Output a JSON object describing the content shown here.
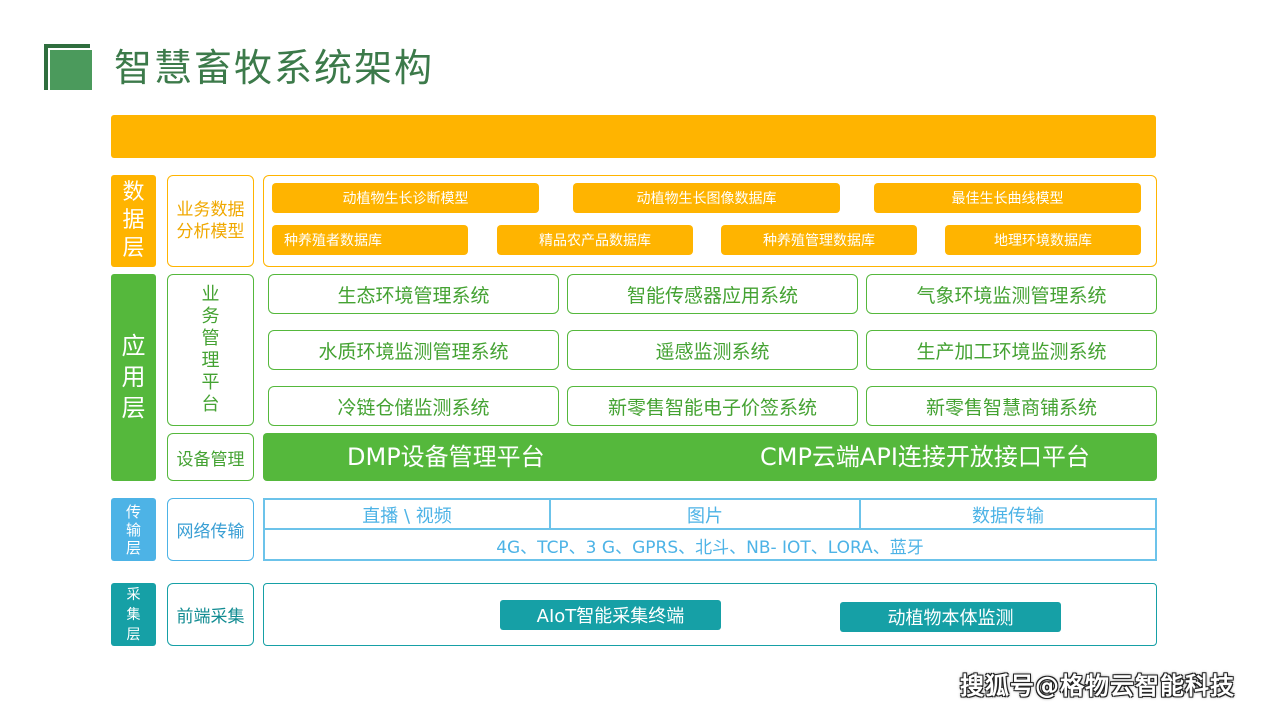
{
  "title": "智慧畜牧系统架构",
  "layers": {
    "data": [
      "数",
      "据",
      "层"
    ],
    "app": [
      "应",
      "用",
      "层"
    ],
    "transport": [
      "传",
      "输",
      "层"
    ],
    "collect": [
      "采",
      "集",
      "层"
    ]
  },
  "labels": {
    "data_model": [
      "业务数据",
      "分析模型"
    ],
    "biz_platform": [
      "业",
      "务",
      "管",
      "理",
      "平",
      "台"
    ],
    "device": "设备管理",
    "network": "网络传输",
    "frontend": "前端采集"
  },
  "data_items": [
    "动植物生长诊断模型",
    "动植物生长图像数据库",
    "最佳生长曲线模型",
    "种养殖者数据库",
    "精品农产品数据库",
    "种养殖管理数据库",
    "地理环境数据库"
  ],
  "app_systems": [
    "生态环境管理系统",
    "智能传感器应用系统",
    "气象环境监测管理系统",
    "水质环境监测管理系统",
    "遥感监测系统",
    "生产加工环境监测系统",
    "冷链仓储监测系统",
    "新零售智能电子价签系统",
    "新零售智慧商铺系统"
  ],
  "platforms": {
    "dmp": "DMP设备管理平台",
    "cmp": "CMP云端API连接开放接口平台"
  },
  "network": {
    "cells": [
      "直播 \\ 视频",
      "图片",
      "数据传输"
    ],
    "protocols": "4G、TCP、3 G、GPRS、北斗、NB- IOT、LORA、蓝牙"
  },
  "collect_items": [
    "AIoT智能采集终端",
    "动植物本体监测"
  ],
  "watermark": "搜狐号@格物云智能科技",
  "colors": {
    "yellow": "#ffb400",
    "green": "#55b83c",
    "blue": "#4db3e6",
    "teal": "#16a0a6",
    "title_green": "#3c7a4a"
  }
}
